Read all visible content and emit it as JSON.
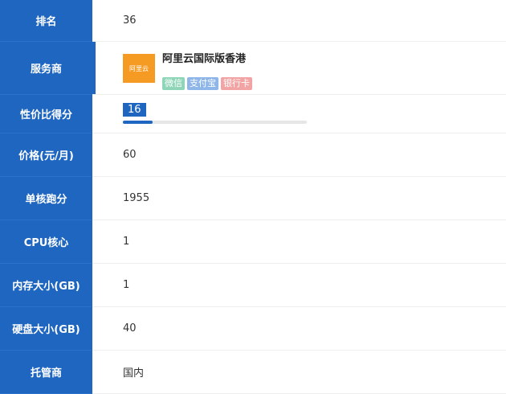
{
  "rows": {
    "rank": {
      "label": "排名",
      "value": "36"
    },
    "provider": {
      "label": "服务商",
      "logo_text": "阿里云",
      "name": "阿里云国际版香港",
      "tags": [
        "微信",
        "支付宝",
        "银行卡"
      ]
    },
    "value_score": {
      "label": "性价比得分",
      "value": "16",
      "progress_pct": 16
    },
    "price": {
      "label": "价格(元/月)",
      "value": "60"
    },
    "single_core": {
      "label": "单核跑分",
      "value": "1955"
    },
    "cpu": {
      "label": "CPU核心",
      "value": "1"
    },
    "memory": {
      "label": "内存大小(GB)",
      "value": "1"
    },
    "disk": {
      "label": "硬盘大小(GB)",
      "value": "40"
    },
    "hosting": {
      "label": "托管商",
      "value": "国内"
    }
  },
  "colors": {
    "accent": "#1f66c1",
    "logo": "#f59a23"
  }
}
